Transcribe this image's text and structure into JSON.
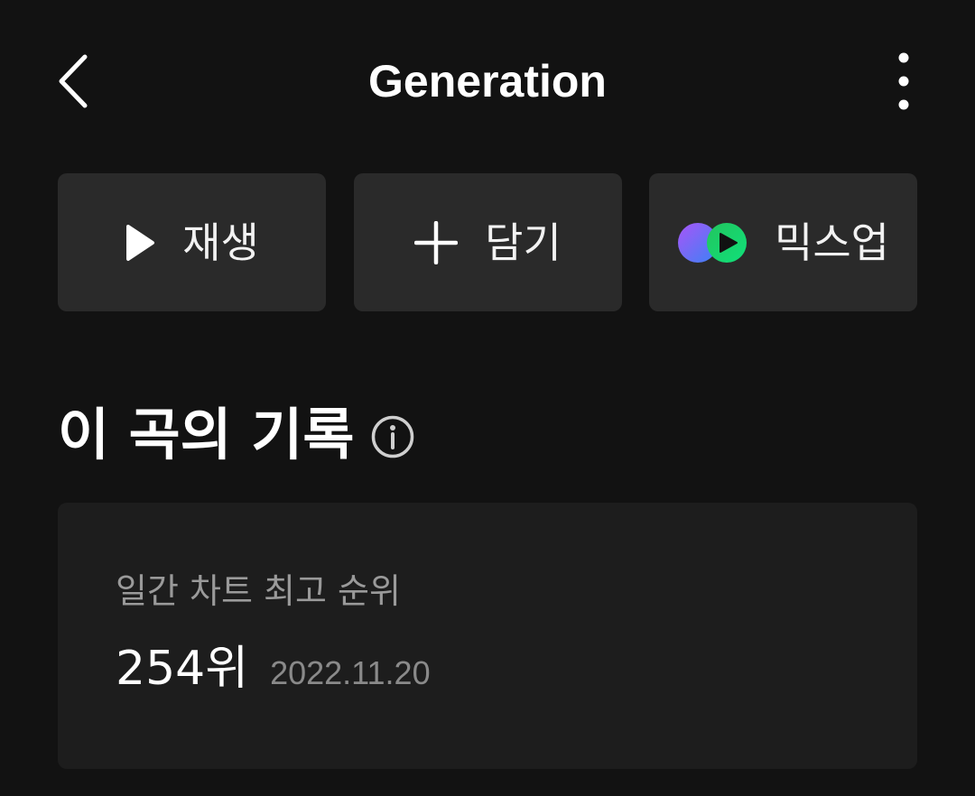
{
  "header": {
    "title": "Generation",
    "back_icon": "chevron-left-icon",
    "more_icon": "more-vertical-icon"
  },
  "actions": {
    "play": {
      "label": "재생",
      "icon": "play-icon"
    },
    "add": {
      "label": "담기",
      "icon": "plus-icon"
    },
    "mixup": {
      "label": "믹스업",
      "icon": "mixup-logo-icon"
    }
  },
  "section": {
    "title": "이 곡의 기록",
    "info_icon": "info-icon"
  },
  "record": {
    "label": "일간 차트 최고 순위",
    "rank": "254위",
    "date": "2022.11.20"
  },
  "colors": {
    "background": "#121212",
    "button_bg": "#2a2a2a",
    "card_bg": "#1d1d1d",
    "mix_purple": "#8b5cf6",
    "mix_blue": "#3b82f6",
    "mix_green": "#22d66b"
  }
}
